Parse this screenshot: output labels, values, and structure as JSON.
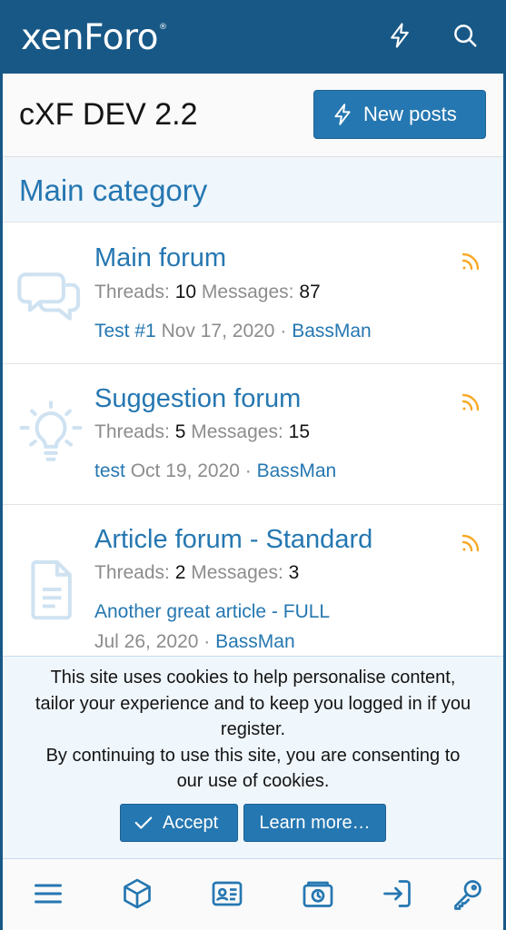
{
  "header": {
    "logo_text": "xenForo",
    "logo_mark": "®",
    "icons": [
      "whats-new-bolt-icon",
      "search-icon"
    ]
  },
  "titlebar": {
    "title": "cXF DEV 2.2",
    "new_posts_label": "New posts"
  },
  "category": {
    "title": "Main category"
  },
  "forums": [
    {
      "title": "Main forum",
      "icon": "chat-bubbles-icon",
      "threads_label": "Threads:",
      "threads": "10",
      "messages_label": "Messages:",
      "messages": "87",
      "latest_title": "Test #1",
      "latest_date": "Nov 17, 2020",
      "separator": "·",
      "latest_user": "BassMan"
    },
    {
      "title": "Suggestion forum",
      "icon": "lightbulb-icon",
      "threads_label": "Threads:",
      "threads": "5",
      "messages_label": "Messages:",
      "messages": "15",
      "latest_title": "test",
      "latest_date": "Oct 19, 2020",
      "separator": "·",
      "latest_user": "BassMan"
    },
    {
      "title": "Article forum - Standard",
      "icon": "document-icon",
      "threads_label": "Threads:",
      "threads": "2",
      "messages_label": "Messages:",
      "messages": "3",
      "latest_title": "Another great article - FULL",
      "latest_date": "Jul 26, 2020",
      "separator": "·",
      "latest_user": "BassMan"
    }
  ],
  "cookie_notice": {
    "line1": "This site uses cookies to help personalise content,",
    "line2": "tailor your experience and to keep you logged in if you",
    "line3": "register.",
    "line4": "By continuing to use this site, you are consenting to",
    "line5": "our use of cookies.",
    "accept_label": "Accept",
    "learn_more_label": "Learn more…"
  },
  "bottom_nav": {
    "items": [
      "menu-icon",
      "cube-icon",
      "id-card-icon",
      "media-icon",
      "login-icon",
      "key-icon"
    ]
  },
  "colors": {
    "header_bg": "#185886",
    "accent": "#2577b1",
    "category_bg": "#eff6fc",
    "rss": "#f9a825",
    "node_icon": "#cfe2f1"
  }
}
